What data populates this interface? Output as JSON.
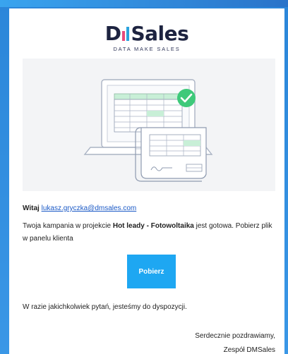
{
  "brand": {
    "logo_prefix": "D",
    "logo_suffix": "Sales",
    "tagline": "DATA MAKE SALES",
    "bar_colors": [
      "#e84a7c",
      "#2ba3dd"
    ]
  },
  "hero": {
    "illustration": "laptop-with-spreadsheet-and-check-icon",
    "check_color": "#3ec97a"
  },
  "email": {
    "greeting_label": "Witaj",
    "recipient": "lukasz.gryczka@dmsales.com",
    "message_part1": "Twoja kampania w projekcie ",
    "project_name": "Hot leady - Fotowoltaika",
    "message_part2": " jest gotowa. Pobierz plik w panelu klienta",
    "cta_label": "Pobierz",
    "questions_text": "W razie jakichkolwiek pytań, jesteśmy do dyspozycji.",
    "signoff_line1": "Serdecznie pozdrawiamy,",
    "signoff_line2": "Zespół DMSales"
  },
  "colors": {
    "frame": "#2b86d9",
    "cta": "#1ea7f2",
    "link": "#1a59c6"
  }
}
